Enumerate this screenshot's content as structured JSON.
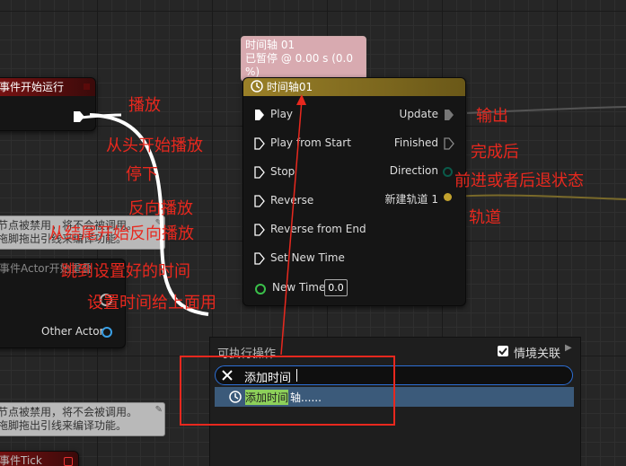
{
  "left_nodes": {
    "begin_play_title": "事件开始运行",
    "disabled_note_1": [
      "节点被禁用，将不会被调用。",
      "拖脚拖出引线来编译功能。"
    ],
    "actor_overlap_title": "事件Actor开始重叠",
    "other_actor_label": "Other Actor",
    "disabled_note_2": [
      "节点被禁用，将不会被调用。",
      "拖脚拖出引线来编译功能。"
    ],
    "tick_title": "事件Tick"
  },
  "tooltip": {
    "line1": "时间轴 01",
    "line2": "已暂停 @ 0.00 s (0.0 %)"
  },
  "timeline_node": {
    "title": "时间轴01",
    "inputs": [
      "Play",
      "Play from Start",
      "Stop",
      "Reverse",
      "Reverse from End",
      "Set New Time"
    ],
    "new_time_label": "New Time",
    "new_time_value": "0.0",
    "outputs": [
      "Update",
      "Finished",
      "Direction",
      "新建轨道 1"
    ]
  },
  "annotations": {
    "play": "播放",
    "play_from_start": "从头开始播放",
    "stop": "停下",
    "reverse": "反向播放",
    "reverse_from_end": "从结尾开始反向播放",
    "set_new_time": "跳到设置好的时间",
    "new_time": "设置时间给上面用",
    "update": "输出",
    "finished": "完成后",
    "direction": "前进或者后退状态",
    "track": "轨道"
  },
  "action_menu": {
    "title": "可执行操作",
    "context_label": "情境关联",
    "context_checked": true,
    "search_value": "添加时间",
    "result_highlight": "添加时间",
    "result_rest": "轴......"
  },
  "colors": {
    "annotation_red": "#e8281e",
    "timeline_header": "#8a7424",
    "event_header": "#8a1a1a",
    "selection_blue": "#3b5a7a"
  }
}
